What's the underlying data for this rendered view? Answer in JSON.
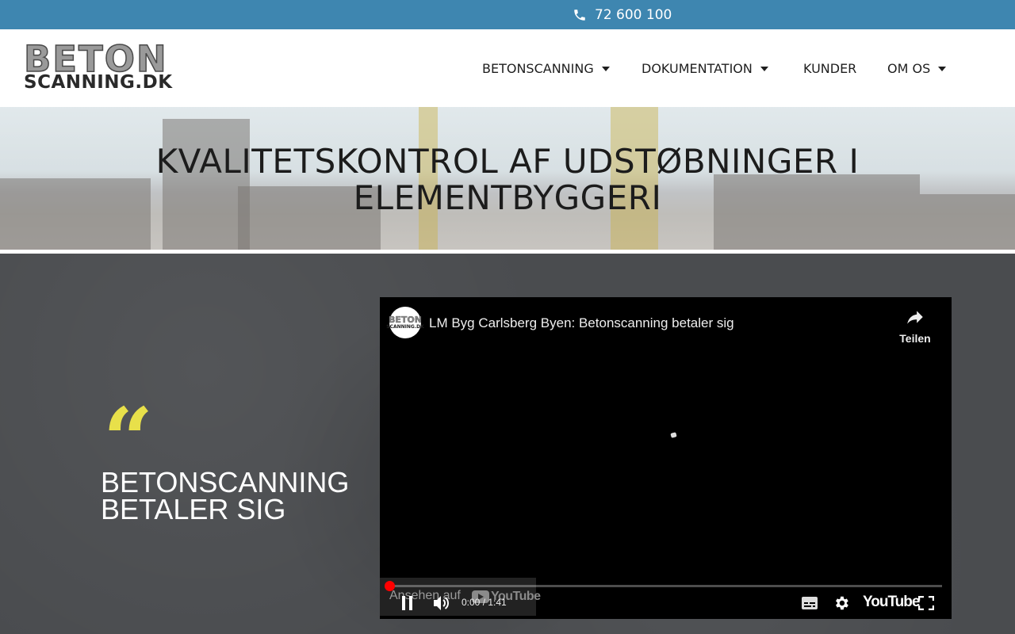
{
  "topbar": {
    "phone": "72 600 100",
    "phone_icon": "phone-icon"
  },
  "header": {
    "logo_line1": "BETON",
    "logo_line2": "SCANNING.DK",
    "nav": [
      {
        "label": "BETONSCANNING",
        "has_dropdown": true
      },
      {
        "label": "DOKUMENTATION",
        "has_dropdown": true
      },
      {
        "label": "KUNDER",
        "has_dropdown": false
      },
      {
        "label": "OM OS",
        "has_dropdown": true
      }
    ]
  },
  "hero": {
    "title_line1": "KVALITETSKONTROL AF UDSTØBNINGER I",
    "title_line2": "ELEMENTBYGGERI"
  },
  "testimonial": {
    "quote_mark": "“",
    "line1": "BETONSCANNING",
    "line2": "BETALER SIG",
    "accent_color": "#e8e04a"
  },
  "video": {
    "channel_avatar_line1": "BETON",
    "channel_avatar_line2": "SCANNING.DK",
    "title": "LM Byg Carlsberg Byen: Betonscanning betaler sig",
    "share_label": "Teilen",
    "watch_on": "Ansehen auf",
    "watch_on_brand": "YouTube",
    "time": "0:00 / 1:41",
    "progress": 0,
    "brand": "YouTube",
    "progress_color": "#ff0000"
  },
  "colors": {
    "topbar": "#3e86b0",
    "dark_bg": "#4a4c4f"
  }
}
